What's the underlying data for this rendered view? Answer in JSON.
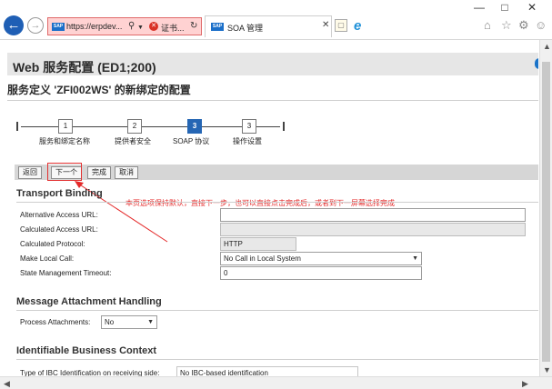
{
  "browser": {
    "url": "https://erpdev...",
    "cert_label": "证书...",
    "tab_title": "SOA 管理",
    "sap_logo": "SAP",
    "window_controls": [
      "minimize-icon",
      "maximize-icon",
      "close-icon"
    ],
    "address_icons": [
      "search-icon",
      "dropdown-icon",
      "certificate-error-icon",
      "refresh-icon"
    ],
    "tool_icons": [
      "home-icon",
      "favorites-star-icon",
      "settings-gear-icon",
      "feedback-smiley-icon"
    ]
  },
  "page": {
    "title": "Web 服务配置 (ED1;200)",
    "subtitle": "服务定义 'ZFI002WS' 的新绑定的配置"
  },
  "roadmap": {
    "steps": [
      {
        "number": "1",
        "label": "服务和绑定名称",
        "active": false
      },
      {
        "number": "2",
        "label": "提供者安全",
        "active": false
      },
      {
        "number": "3",
        "label": "SOAP 协议",
        "active": true
      },
      {
        "number": "3",
        "label": "操作设置",
        "active": false
      }
    ]
  },
  "toolbar": {
    "back": "返回",
    "next": "下一个",
    "finish": "完成",
    "cancel": "取消"
  },
  "annotation": "本页选项保持默认，直接下一步，也可以直接点击完成后，或者到下一屏幕选择完成",
  "transport": {
    "title": "Transport Binding",
    "alt_url_label": "Alternative Access URL:",
    "alt_url_value": "",
    "calc_url_label": "Calculated Access URL:",
    "calc_url_value": "",
    "calc_protocol_label": "Calculated Protocol:",
    "calc_protocol_value": "HTTP",
    "local_call_label": "Make Local Call:",
    "local_call_value": "No Call in Local System",
    "timeout_label": "State Management Timeout:",
    "timeout_value": "0"
  },
  "message": {
    "title": "Message Attachment Handling",
    "process_label": "Process Attachments:",
    "process_value": "No"
  },
  "ibc": {
    "title": "Identifiable Business Context",
    "type_label": "Type of IBC Identification on receiving side:",
    "type_value": "No IBC-based identification"
  }
}
